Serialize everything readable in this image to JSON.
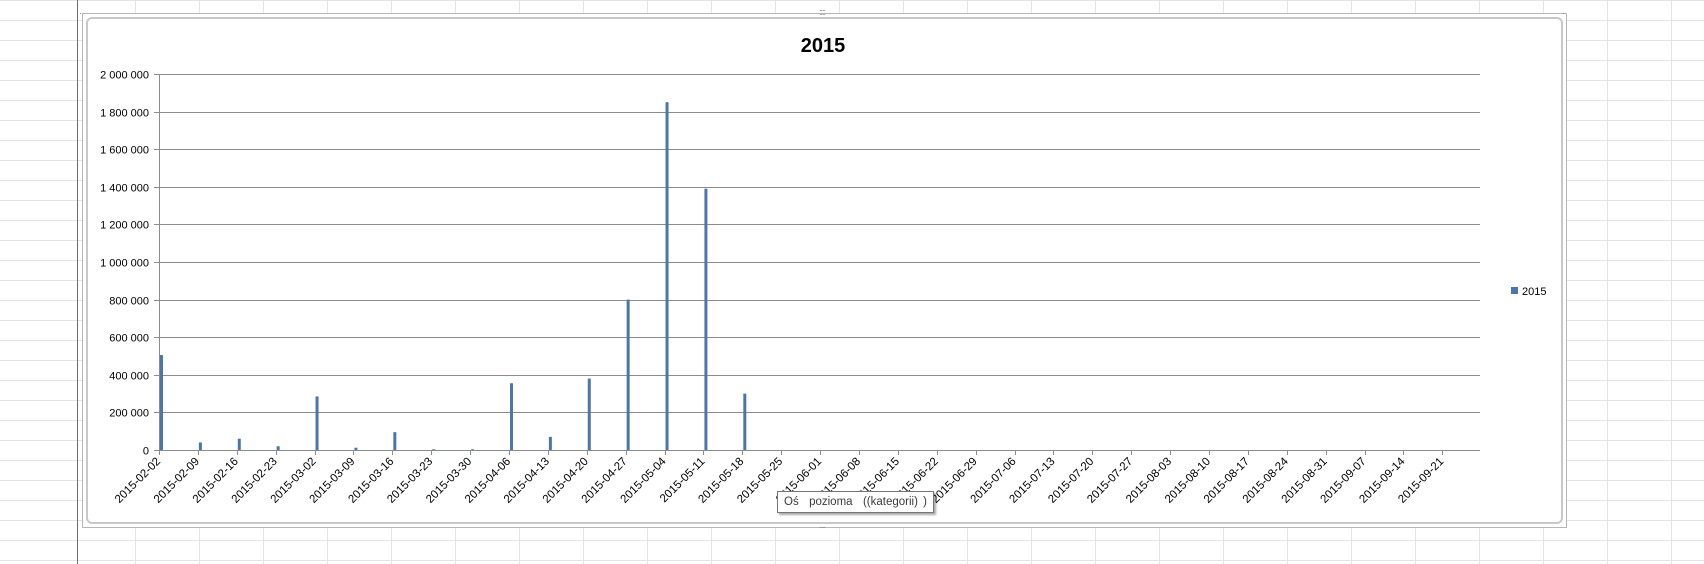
{
  "chart_data": {
    "type": "bar",
    "title": "2015",
    "xlabel": "",
    "ylabel": "",
    "ylim": [
      0,
      2000000
    ],
    "yticks": [
      "0",
      "200 000",
      "400 000",
      "600 000",
      "800 000",
      "1 000 000",
      "1 200 000",
      "1 400 000",
      "1 600 000",
      "1 800 000",
      "2 000 000"
    ],
    "categories": [
      "2015-02-02",
      "2015-02-09",
      "2015-02-16",
      "2015-02-23",
      "2015-03-02",
      "2015-03-09",
      "2015-03-16",
      "2015-03-23",
      "2015-03-30",
      "2015-04-06",
      "2015-04-13",
      "2015-04-20",
      "2015-04-27",
      "2015-05-04",
      "2015-05-11",
      "2015-05-18",
      "2015-05-25",
      "2015-06-01",
      "2015-06-08",
      "2015-06-15",
      "2015-06-22",
      "2015-06-29",
      "2015-07-06",
      "2015-07-13",
      "2015-07-20",
      "2015-07-27",
      "2015-08-03",
      "2015-08-10",
      "2015-08-17",
      "2015-08-24",
      "2015-08-31",
      "2015-09-07",
      "2015-09-14",
      "2015-09-21"
    ],
    "series": [
      {
        "name": "2015",
        "values": [
          505000,
          40000,
          60000,
          20000,
          285000,
          12000,
          95000,
          4000,
          4000,
          355000,
          70000,
          380000,
          800000,
          1850000,
          1390000,
          300000,
          0,
          0,
          0,
          0,
          0,
          0,
          0,
          0,
          0,
          0,
          0,
          0,
          0,
          0,
          0,
          0,
          0,
          0
        ]
      }
    ],
    "grid": true,
    "legend": "right",
    "colors": {
      "series": "#4a76ab",
      "gridline": "#8c8c8c",
      "axis": "#8c8c8c"
    }
  },
  "tooltip": {
    "text": "Oś  pozioma  ((kategorii) )"
  }
}
